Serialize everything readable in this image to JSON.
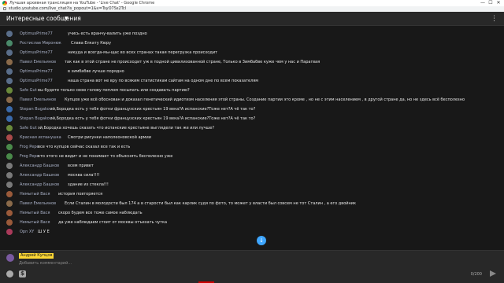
{
  "window": {
    "title": "Лучшая архивная трансляция на YouTube - 'Live Chat' - Google Chrome",
    "url": "studio.youtube.com/live_chat?is_popout=1&v=TsyO7Ss2TcI",
    "minimize": "—",
    "maximize": "☐",
    "close": "✕"
  },
  "header": {
    "title": "Интересные сообщения",
    "caret": "▼",
    "more": "⋮"
  },
  "messages": [
    {
      "author": "OptimusPrime77",
      "text": "учись есть вранчу-валить уже поздно"
    },
    {
      "author": "Ростислав Миронюк",
      "text": "Слава Елкату Кюру"
    },
    {
      "author": "OptimusPrime77",
      "text": "никуда и всегда-мы-щас во всех странах такая перегрузка происходит"
    },
    {
      "author": "Павел Емельянов",
      "text": "так как в этой стране не происходит уж в подной цивилизованной стране, Только в Зимбабве куже чем у нас и Парагвая"
    },
    {
      "author": "OptimusPrime77",
      "text": "в зимбабве лучше порядно"
    },
    {
      "author": "OptimusPrime77",
      "text": "наша страна вот не вру по всяким статистикам сайтам на одном дне по всем показателям"
    },
    {
      "author": "Safe Gut",
      "text": "вы будете только свою голову пеплом посыпать или создавать партию?"
    },
    {
      "author": "Павел Емельянов",
      "text": "Купцов уже всё обоснован и доказал генетический идиотизм населения этой страны. Создание партии это кроме , но не с этим населением , в другой стране да, но не здесь всё бесполезно"
    },
    {
      "author": "Stepan Bugakov",
      "text": "эй,Бородка есть у тебя фотки французских крестьян 19 века?А испанские?Тоже нет?А чё так то?"
    },
    {
      "author": "Stepan Bugakov",
      "text": "эй,Бородка есть у тебя фотки французских крестьян 19 века?А испанские?Тоже нет?А чё так то?"
    },
    {
      "author": "Safe Gut",
      "text": "эй,Бородка хочешь сказать что испанские крестьяне выглядели так же или лучше?"
    },
    {
      "author": "Красная испанушка",
      "text": "Смотри рисунки наполеоновской армии"
    },
    {
      "author": "Frog Pepe",
      "text": "все что купцов сейчас сказал все так и есть"
    },
    {
      "author": "Frog Pepe",
      "text": "кто этого не видит и не понимает то объяснять бесполезно уже"
    },
    {
      "author": "Александр Башков",
      "text": "всем привет"
    },
    {
      "author": "Александр Башков",
      "text": "москва сила!!!!"
    },
    {
      "author": "Александр Башков",
      "text": "здание из стекла!!!"
    },
    {
      "author": "Немытый Вася",
      "text": "история повторяется"
    },
    {
      "author": "Павел Емельянов",
      "text": "Если Сталин в молодости был 174 а в старости был как карлик судя по фото, то может у власти был совсем не тот Сталин , а его двойник"
    },
    {
      "author": "Немытый Вася",
      "text": "скоро будем все тоже самое наблюдать"
    },
    {
      "author": "Немытый Вася",
      "text": "да уже наблюдаем стоит от москвы отъехать чутка"
    },
    {
      "author": "Opn XY",
      "text": "Ш У Е"
    }
  ],
  "input": {
    "username": "Андрей Купцов",
    "placeholder": "Добавить комментарий..."
  },
  "toolbar": {
    "counter": "0/200",
    "money_glyph": "$"
  },
  "scroll_down_glyph": "↓",
  "colors": {
    "accent": "#3ea6ff",
    "username_badge": "#fdd835",
    "background": "#181818"
  }
}
